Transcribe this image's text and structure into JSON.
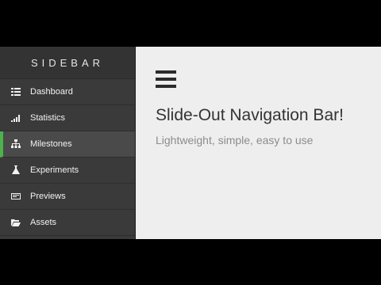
{
  "sidebar": {
    "title": "SIDEBAR",
    "items": [
      {
        "label": "Dashboard",
        "icon": "grid-icon",
        "active": false
      },
      {
        "label": "Statistics",
        "icon": "signal-bars-icon",
        "active": false
      },
      {
        "label": "Milestones",
        "icon": "sitemap-icon",
        "active": true
      },
      {
        "label": "Experiments",
        "icon": "flask-icon",
        "active": false
      },
      {
        "label": "Previews",
        "icon": "card-icon",
        "active": false
      },
      {
        "label": "Assets",
        "icon": "folder-open-icon",
        "active": false
      }
    ],
    "active_accent": "#4cb24c"
  },
  "main": {
    "menu_icon": "hamburger-icon",
    "headline": "Slide-Out Navigation Bar!",
    "subline": "Lightweight, simple, easy to use"
  }
}
